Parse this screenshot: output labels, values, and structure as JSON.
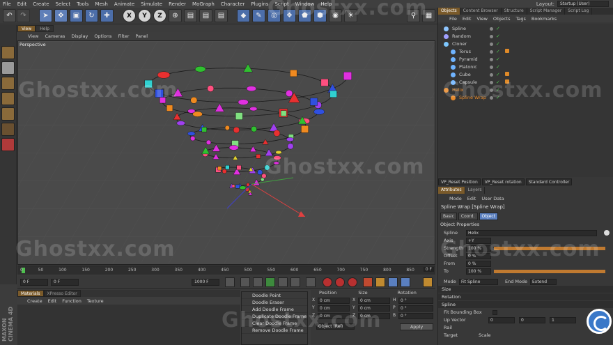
{
  "menubar": {
    "items": [
      "File",
      "Edit",
      "Create",
      "Select",
      "Tools",
      "Mesh",
      "Animate",
      "Simulate",
      "Render",
      "MoGraph",
      "Character",
      "Plugins",
      "Script",
      "Window",
      "Help"
    ],
    "layout_label": "Layout:",
    "layout_value": "Startup (User)"
  },
  "toolbar": {
    "axis_x": "X",
    "axis_y": "Y",
    "axis_z": "Z"
  },
  "viewport": {
    "tabs": [
      "View",
      "Help"
    ],
    "menu": [
      "View",
      "Cameras",
      "Display",
      "Options",
      "Filter",
      "Panel"
    ],
    "label": "Perspective"
  },
  "timeline": {
    "ticks": [
      "0",
      "50",
      "100",
      "150",
      "200",
      "250",
      "300",
      "350",
      "400",
      "450",
      "500",
      "550",
      "600",
      "650",
      "700",
      "750",
      "800",
      "850"
    ],
    "end_frame": "0 F"
  },
  "transport": {
    "current": "0 F",
    "start": "0 F",
    "end": "1000 F",
    "max": "1000 F"
  },
  "materials": {
    "tabs": [
      "Materials",
      "XPresso Editor"
    ],
    "menu": [
      "Create",
      "Edit",
      "Function",
      "Texture"
    ],
    "brand": "MAXON CINEMA 4D"
  },
  "doodle_menu": [
    "Doodle Point",
    "Doodle Eraser",
    "Add Doodle Frame",
    "Duplicate Doodle Frame",
    "Clear Doodle Frame",
    "Remove Doodle Frame"
  ],
  "coords": {
    "headers": [
      "Position",
      "Size",
      "Rotation"
    ],
    "rows": [
      {
        "a": "X",
        "av": "0 cm",
        "b": "X",
        "bv": "0 cm",
        "c": "H",
        "cv": "0 °"
      },
      {
        "a": "Y",
        "av": "0 cm",
        "b": "Y",
        "bv": "0 cm",
        "c": "P",
        "cv": "0 °"
      },
      {
        "a": "Z",
        "av": "0 cm",
        "b": "Z",
        "bv": "0 cm",
        "c": "B",
        "cv": "0 °"
      }
    ],
    "mode": "Object (Rel)",
    "apply": "Apply"
  },
  "right_tabs": [
    "Objects",
    "Content Browser",
    "Structure",
    "Script Manager",
    "Script Log"
  ],
  "objects_menu": [
    "File",
    "Edit",
    "View",
    "Objects",
    "Tags",
    "Bookmarks"
  ],
  "objects": [
    {
      "name": "Spline",
      "indent": 0,
      "color": "#8fc6ff"
    },
    {
      "name": "Random",
      "indent": 0,
      "color": "#a0a0ff"
    },
    {
      "name": "Cloner",
      "indent": 0,
      "color": "#7ec8ff"
    },
    {
      "name": "Torus",
      "indent": 1,
      "color": "#6fb4ff",
      "tag": true
    },
    {
      "name": "Pyramid",
      "indent": 1,
      "color": "#6fb4ff"
    },
    {
      "name": "Platonic",
      "indent": 1,
      "color": "#6fb4ff"
    },
    {
      "name": "Cube",
      "indent": 1,
      "color": "#6fb4ff",
      "tag": true
    },
    {
      "name": "Capsule",
      "indent": 1,
      "color": "#6fb4ff",
      "tag": true
    },
    {
      "name": "Helix",
      "indent": 0,
      "color": "#e88a2a",
      "hl": true
    },
    {
      "name": "Spline Wrap",
      "indent": 1,
      "color": "#e88a2a",
      "hl": true
    }
  ],
  "presets": [
    "VP_Reset Position",
    "VP_Reset rotation",
    "Standard Controller"
  ],
  "attr_tabs": [
    "Attributes",
    "Layers"
  ],
  "attr_menu": [
    "Mode",
    "Edit",
    "User Data"
  ],
  "attr_title": "Spline Wrap [Spline Wrap]",
  "attr_subtabs": [
    "Basic",
    "Coord.",
    "Object"
  ],
  "object_props": {
    "header": "Object Properties",
    "spline_label": "Spline",
    "spline_value": "Helix",
    "axis_label": "Axis",
    "axis_value": "+Y",
    "strength_label": "Strength",
    "strength_value": "100 %",
    "strength": 1.0,
    "offset_label": "Offset",
    "offset_value": "0 %",
    "from_label": "From",
    "from_value": "0 %",
    "to_label": "To",
    "to_value": "100 %",
    "to": 1.0,
    "mode_label": "Mode",
    "mode_value": "Fit Spline",
    "endmode_label": "End Mode",
    "endmode_value": "Extend"
  },
  "sections": [
    "Size",
    "Rotation",
    "Spline"
  ],
  "spline_props": {
    "fit_label": "Fit Bounding Box",
    "up_label": "Up Vector",
    "up_x": "0",
    "up_y": "0",
    "up_z": "1",
    "rail_label": "Rail",
    "target_label": "Target",
    "scale_label": "Scale"
  },
  "watermark": "Ghostxx.com",
  "colors": {
    "accent": "#7a5a2a",
    "select": "#5a7fbf",
    "highlight": "#e88a2a",
    "check": "#4ec04e"
  }
}
